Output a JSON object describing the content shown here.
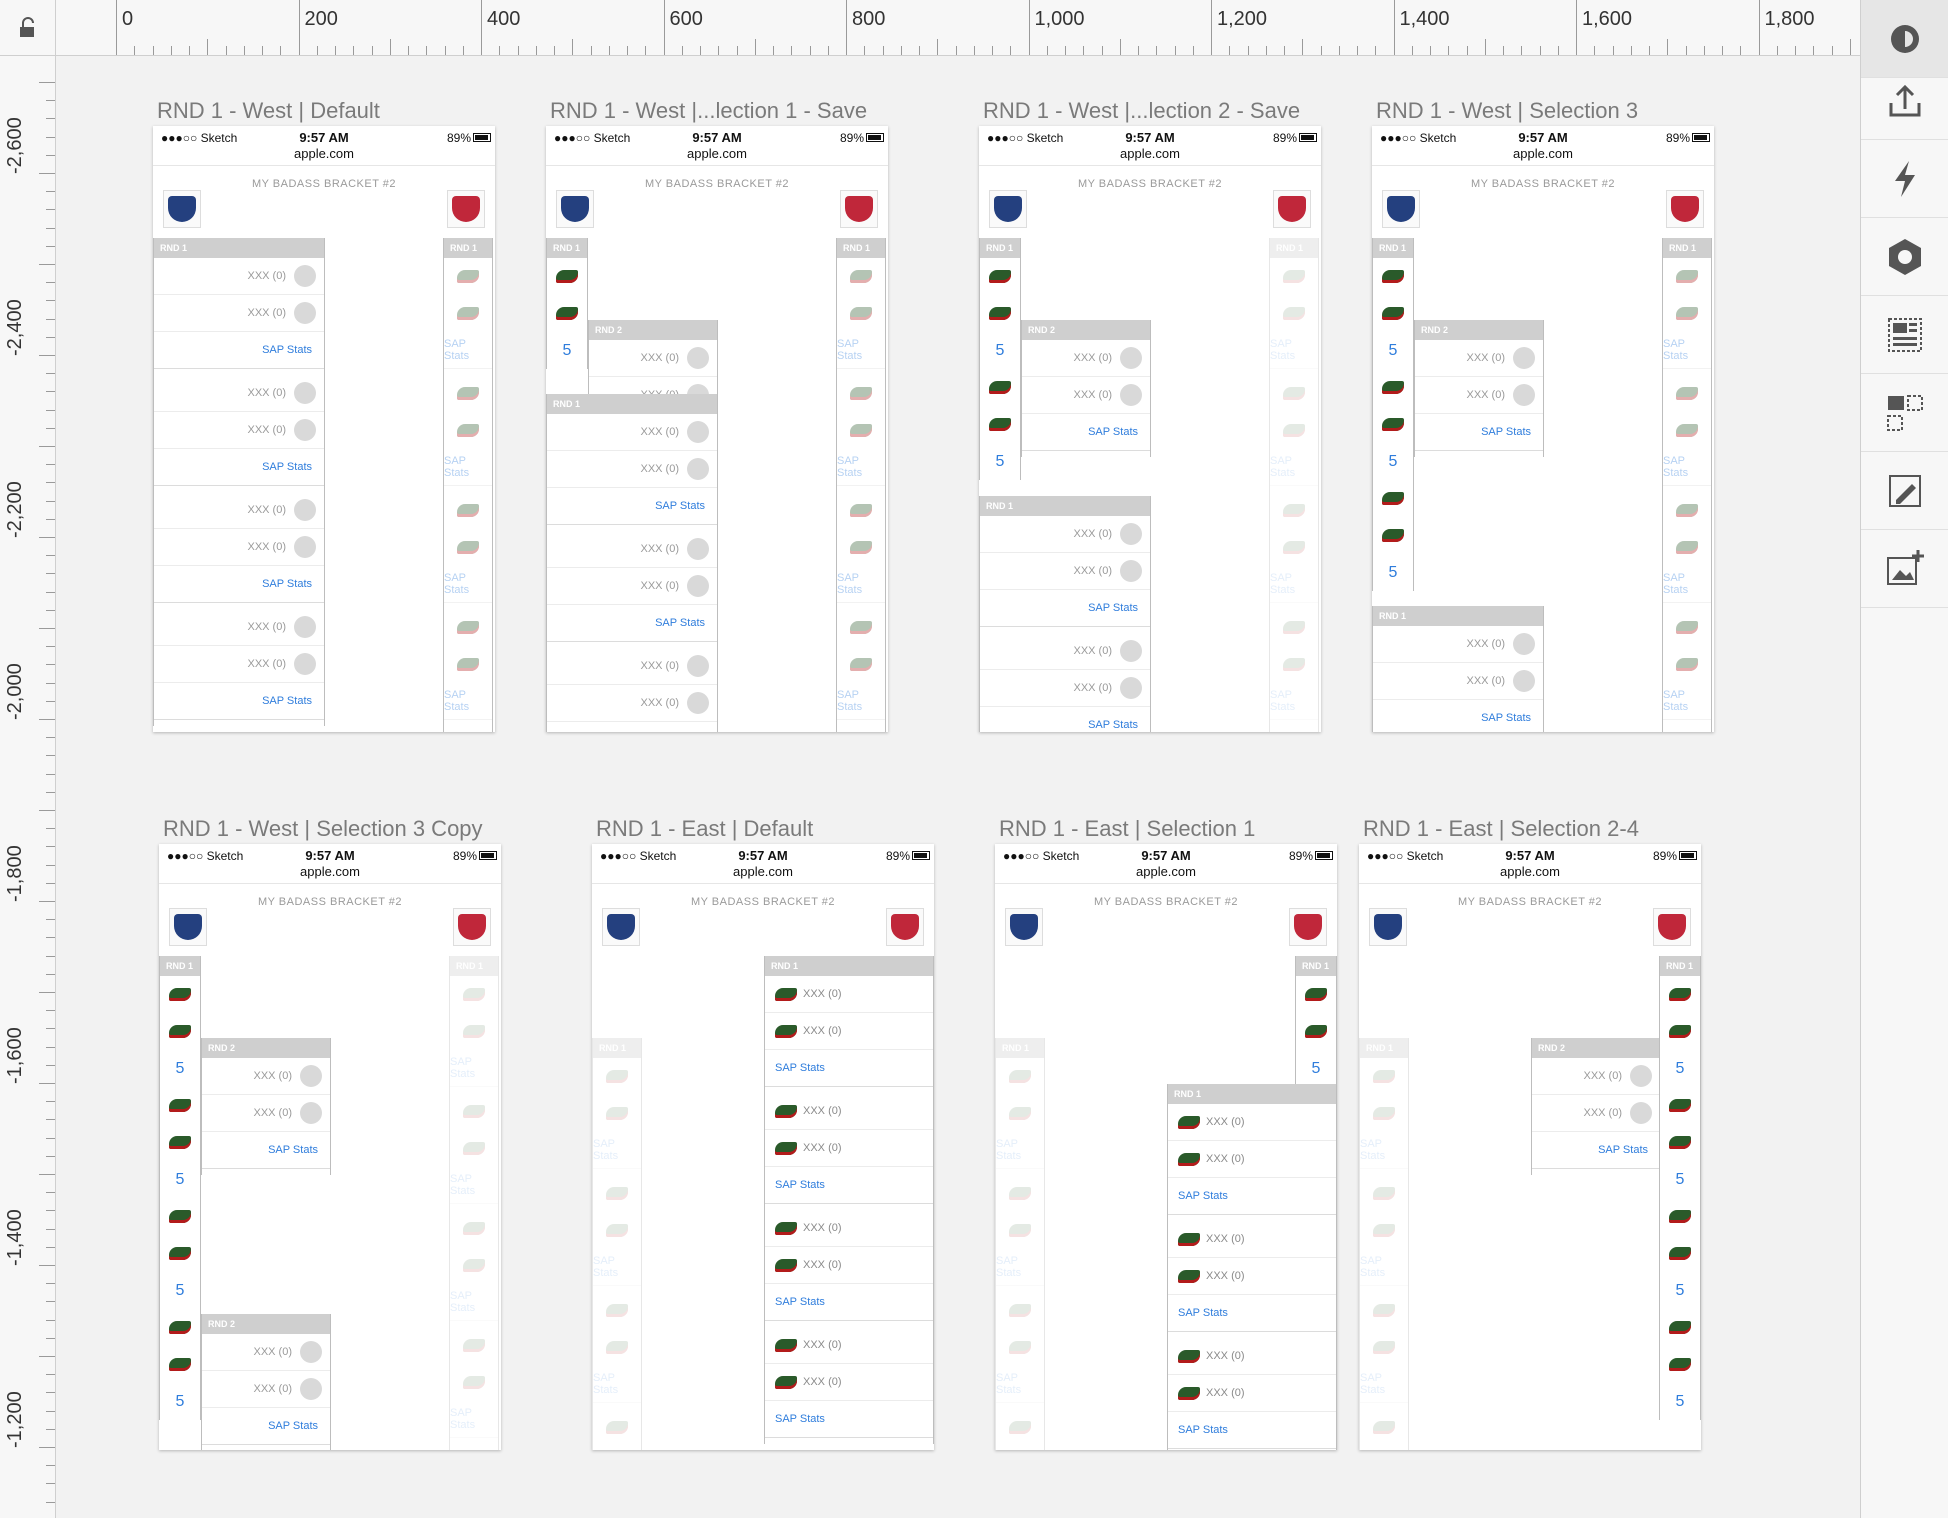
{
  "ruler": {
    "corner_icon": "lock-open-icon",
    "top_labels": [
      "0",
      "200",
      "400",
      "600",
      "800",
      "1,000",
      "1,200",
      "1,400",
      "1,600",
      "1,800"
    ],
    "left_labels": [
      "-2,600",
      "-2,400",
      "-2,200",
      "-2,000",
      "-1,800",
      "-1,600",
      "-1,400",
      "-1,200"
    ]
  },
  "toolbar": {
    "items": [
      "app-logo-icon",
      "export-icon",
      "lightning-icon",
      "hexagon-icon",
      "layout-icon",
      "selection-icon",
      "edit-artboard-icon",
      "add-image-icon"
    ]
  },
  "common": {
    "carrier": "●●●○○ Sketch",
    "time": "9:57 AM",
    "url": "apple.com",
    "battery": "89%",
    "bracket_title": "MY BADASS BRACKET #2",
    "rnd1": "RND 1",
    "rnd2": "RND 2",
    "xxx": "XXX (0)",
    "sap_stats": "SAP  Stats",
    "sap_stats_east": "SAP Stats",
    "five": "5"
  },
  "artboards": [
    {
      "title": "RND 1 - West | Default"
    },
    {
      "title": "RND 1 - West |...lection 1 - Save"
    },
    {
      "title": "RND 1 - West |...lection 2 - Save"
    },
    {
      "title": "RND 1 - West | Selection 3"
    },
    {
      "title": "RND 1 - West | Selection 3 Copy"
    },
    {
      "title": "RND 1 - East | Default"
    },
    {
      "title": "RND 1 - East | Selection 1"
    },
    {
      "title": "RND 1 - East | Selection 2-4"
    }
  ]
}
